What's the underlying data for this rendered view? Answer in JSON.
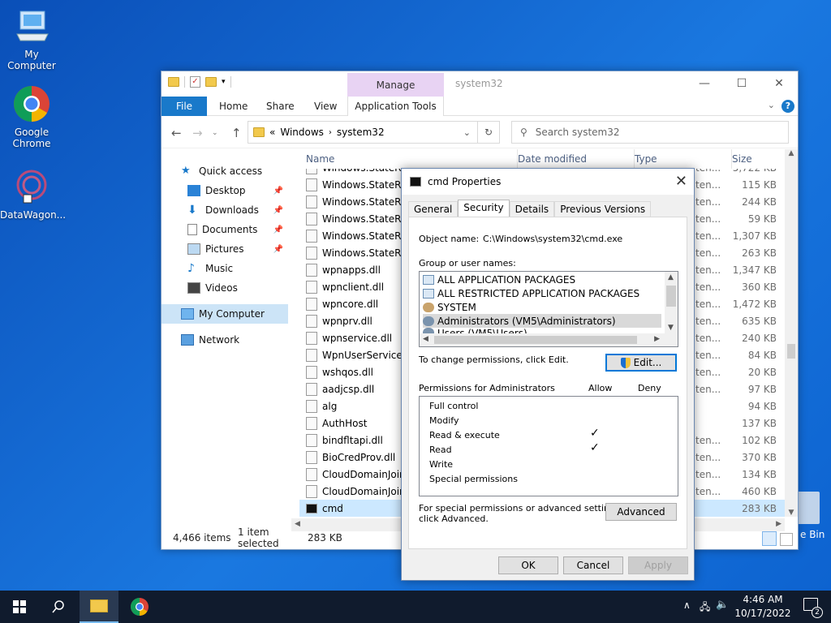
{
  "desktop": {
    "icons": [
      {
        "label": "My Computer"
      },
      {
        "label": "Google Chrome"
      },
      {
        "label": "DataWagon..."
      }
    ],
    "recycle_partial": "e Bin"
  },
  "explorer": {
    "title": "system32",
    "manage_label": "Manage",
    "ribbon_tabs": {
      "file": "File",
      "home": "Home",
      "share": "Share",
      "view": "View",
      "app_tools": "Application Tools"
    },
    "address": {
      "sep": "«",
      "crumb1": "Windows",
      "crumb2": "system32"
    },
    "search_placeholder": "Search system32",
    "nav": {
      "quick_access": "Quick access",
      "desktop": "Desktop",
      "downloads": "Downloads",
      "documents": "Documents",
      "pictures": "Pictures",
      "music": "Music",
      "videos": "Videos",
      "my_computer": "My Computer",
      "network": "Network"
    },
    "columns": {
      "name": "Name",
      "date": "Date modified",
      "type": "Type",
      "size": "Size"
    },
    "files": [
      {
        "name": "Windows.StateRep",
        "type": "ten...",
        "size": "5,722 KB"
      },
      {
        "name": "Windows.StateRep",
        "type": "ten...",
        "size": "115 KB"
      },
      {
        "name": "Windows.StateRep",
        "type": "ten...",
        "size": "244 KB"
      },
      {
        "name": "Windows.StateRep",
        "type": "ten...",
        "size": "59 KB"
      },
      {
        "name": "Windows.StateRep",
        "type": "ten...",
        "size": "1,307 KB"
      },
      {
        "name": "Windows.StateRep",
        "type": "ten...",
        "size": "263 KB"
      },
      {
        "name": "wpnapps.dll",
        "type": "ten...",
        "size": "1,347 KB"
      },
      {
        "name": "wpnclient.dll",
        "type": "ten...",
        "size": "360 KB"
      },
      {
        "name": "wpncore.dll",
        "type": "ten...",
        "size": "1,472 KB"
      },
      {
        "name": "wpnprv.dll",
        "type": "ten...",
        "size": "635 KB"
      },
      {
        "name": "wpnservice.dll",
        "type": "ten...",
        "size": "240 KB"
      },
      {
        "name": "WpnUserService.dll",
        "type": "ten...",
        "size": "84 KB"
      },
      {
        "name": "wshqos.dll",
        "type": "ten...",
        "size": "20 KB"
      },
      {
        "name": "aadjcsp.dll",
        "type": "ten...",
        "size": "97 KB"
      },
      {
        "name": "alg",
        "type": "",
        "size": "94 KB"
      },
      {
        "name": "AuthHost",
        "type": "",
        "size": "137 KB"
      },
      {
        "name": "bindfltapi.dll",
        "type": "ten...",
        "size": "102 KB"
      },
      {
        "name": "BioCredProv.dll",
        "type": "ten...",
        "size": "370 KB"
      },
      {
        "name": "CloudDomainJoinA",
        "type": "ten...",
        "size": "134 KB"
      },
      {
        "name": "CloudDomainJoinD",
        "type": "ten...",
        "size": "460 KB"
      },
      {
        "name": "cmd",
        "type": "",
        "size": "283 KB"
      }
    ],
    "status": {
      "count": "4,466 items",
      "selected": "1 item selected",
      "size": "283 KB"
    }
  },
  "dialog": {
    "title": "cmd Properties",
    "tabs": {
      "general": "General",
      "security": "Security",
      "details": "Details",
      "previous": "Previous Versions"
    },
    "object_label": "Object name:",
    "object_value": "C:\\Windows\\system32\\cmd.exe",
    "group_label": "Group or user names:",
    "users": [
      "ALL APPLICATION PACKAGES",
      "ALL RESTRICTED APPLICATION PACKAGES",
      "SYSTEM",
      "Administrators (VM5\\Administrators)",
      "Users (VM5\\Users)"
    ],
    "change_text": "To change permissions, click Edit.",
    "edit_label": "Edit...",
    "perm_label": "Permissions for Administrators",
    "allow": "Allow",
    "deny": "Deny",
    "permissions": [
      {
        "name": "Full control",
        "allow": ""
      },
      {
        "name": "Modify",
        "allow": ""
      },
      {
        "name": "Read & execute",
        "allow": "✓"
      },
      {
        "name": "Read",
        "allow": "✓"
      },
      {
        "name": "Write",
        "allow": ""
      },
      {
        "name": "Special permissions",
        "allow": ""
      }
    ],
    "special_line1": "For special permissions or advanced settings,",
    "special_line2": "click Advanced.",
    "advanced_label": "Advanced",
    "ok": "OK",
    "cancel": "Cancel",
    "apply": "Apply"
  },
  "taskbar": {
    "time": "4:46 AM",
    "date": "10/17/2022",
    "notif_count": "2"
  }
}
